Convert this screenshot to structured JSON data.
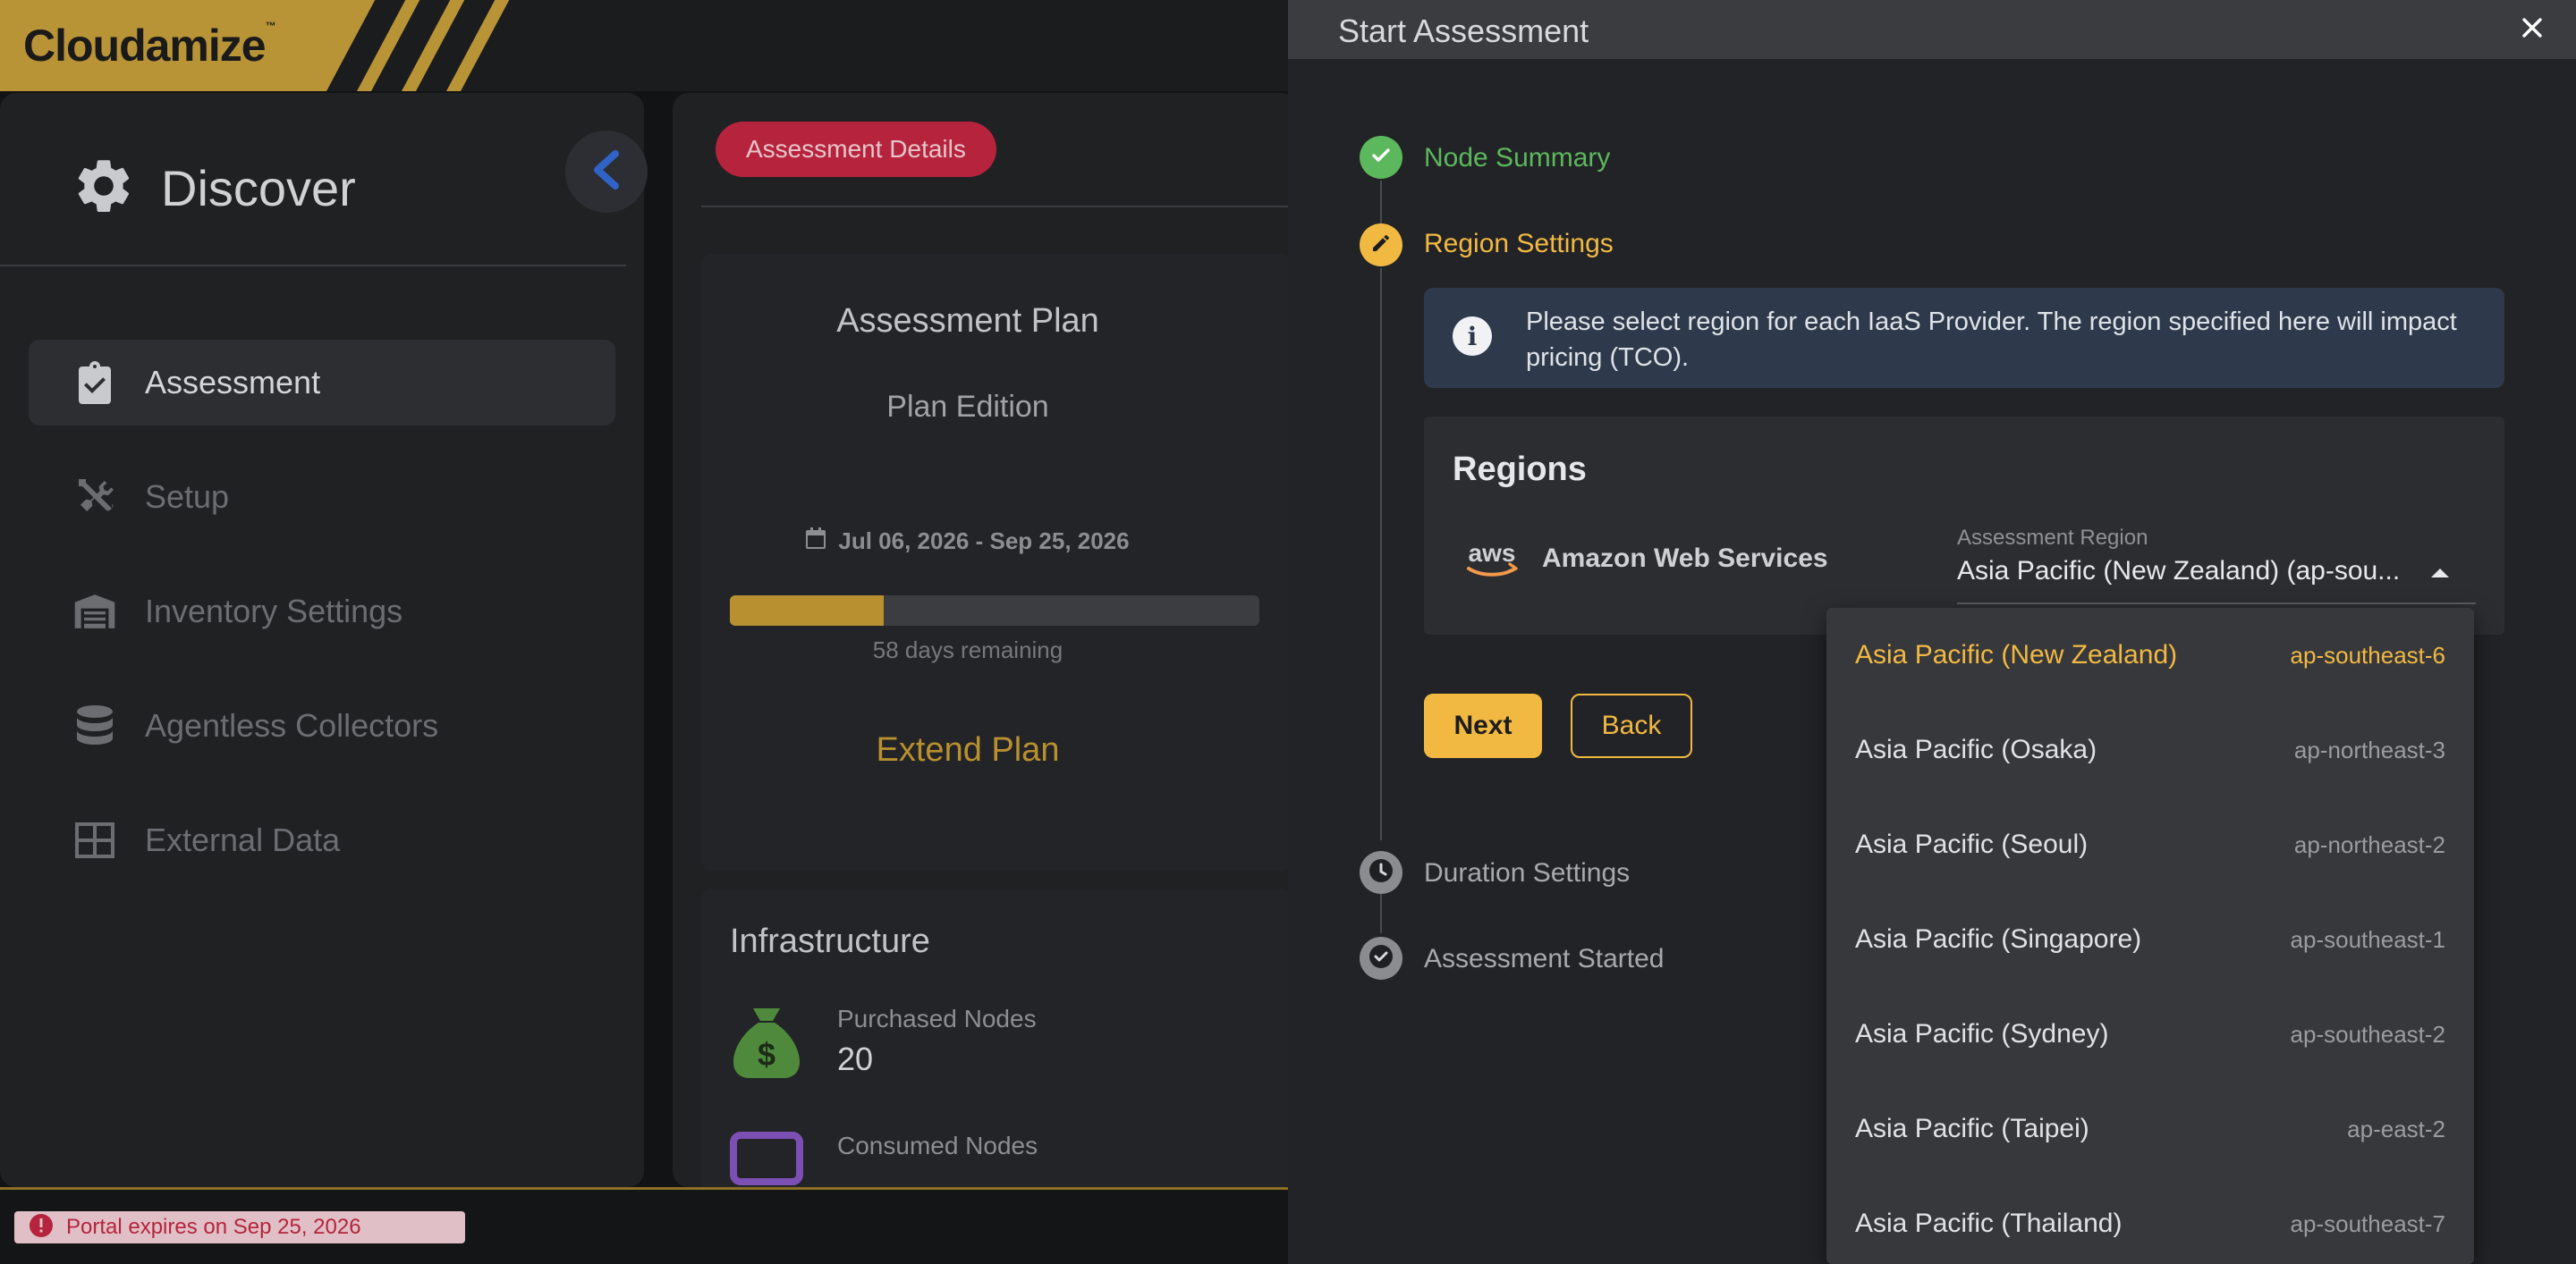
{
  "app": {
    "logo": "Cloudamize",
    "logo_tm": "™"
  },
  "sidebar": {
    "title": "Discover",
    "items": [
      {
        "label": "Assessment",
        "icon": "clipboard-check-icon",
        "active": true
      },
      {
        "label": "Setup",
        "icon": "tools-icon",
        "active": false
      },
      {
        "label": "Inventory Settings",
        "icon": "warehouse-icon",
        "active": false
      },
      {
        "label": "Agentless Collectors",
        "icon": "database-icon",
        "active": false
      },
      {
        "label": "External Data",
        "icon": "table-icon",
        "active": false
      }
    ]
  },
  "main": {
    "tag": "Assessment Details",
    "plan": {
      "title": "Assessment Plan",
      "edition": "Plan Edition",
      "dates": "Jul 06, 2026 - Sep 25, 2026",
      "progress_fraction": 0.29,
      "days_remaining": "58 days remaining",
      "extend_label": "Extend Plan"
    },
    "infrastructure": {
      "title": "Infrastructure",
      "purchased_label": "Purchased Nodes",
      "purchased_value": "20",
      "consumed_label": "Consumed Nodes"
    }
  },
  "footer": {
    "expire_text": "Portal expires on Sep 25, 2026"
  },
  "drawer": {
    "title": "Start Assessment",
    "steps": [
      {
        "label": "Node Summary",
        "state": "done"
      },
      {
        "label": "Region Settings",
        "state": "active"
      },
      {
        "label": "Duration Settings",
        "state": "pending"
      },
      {
        "label": "Assessment Started",
        "state": "pending"
      }
    ],
    "info": "Please select region for each IaaS Provider. The region specified here will impact pricing (TCO).",
    "regions": {
      "title": "Regions",
      "provider_logo": "aws",
      "provider": "Amazon Web Services",
      "field_label": "Assessment Region",
      "field_value": "Asia Pacific (New Zealand) (ap-sou..."
    },
    "next_label": "Next",
    "back_label": "Back",
    "dropdown": [
      {
        "name": "Asia Pacific (New Zealand)",
        "code": "ap-southeast-6",
        "selected": true
      },
      {
        "name": "Asia Pacific (Osaka)",
        "code": "ap-northeast-3"
      },
      {
        "name": "Asia Pacific (Seoul)",
        "code": "ap-northeast-2"
      },
      {
        "name": "Asia Pacific (Singapore)",
        "code": "ap-southeast-1"
      },
      {
        "name": "Asia Pacific (Sydney)",
        "code": "ap-southeast-2"
      },
      {
        "name": "Asia Pacific (Taipei)",
        "code": "ap-east-2"
      },
      {
        "name": "Asia Pacific (Thailand)",
        "code": "ap-southeast-7"
      }
    ]
  },
  "colors": {
    "accent": "#f2b942",
    "brand_gold": "#b99437",
    "success": "#5cb85c",
    "tag_red": "#b5243c"
  }
}
